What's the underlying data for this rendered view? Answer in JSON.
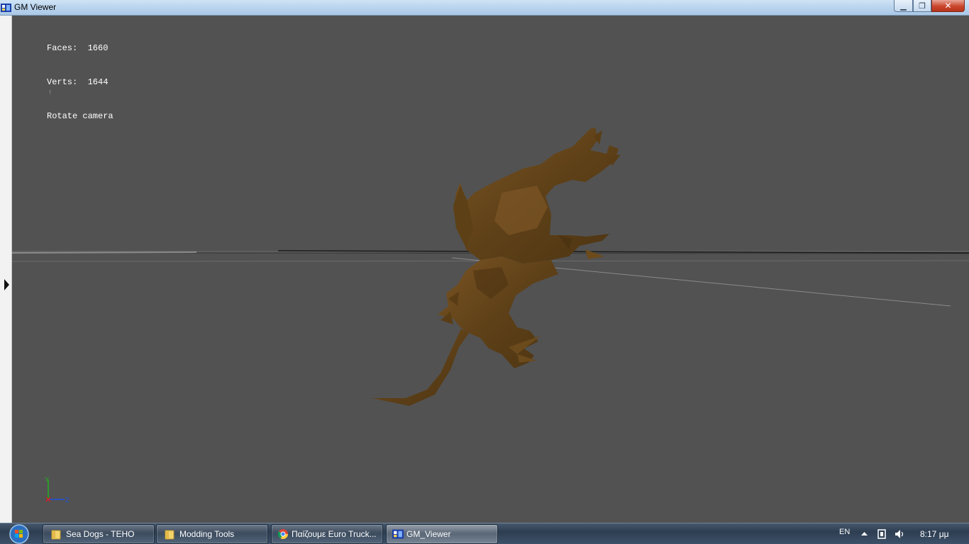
{
  "window": {
    "title": "GM Viewer",
    "icon": "gm-viewer-app-icon",
    "controls": {
      "minimize": "▁",
      "maximize": "❐",
      "close": "✕"
    }
  },
  "sidebar": {
    "toggle_icon": "triangle-right-icon"
  },
  "hud": {
    "faces_line": "Faces:  1660",
    "verts_line": "Verts:  1644",
    "mode_line": "Rotate camera",
    "marker": "!"
  },
  "axis_gizmo": {
    "y_label": "Y",
    "x_label": "X",
    "z_label": "Z"
  },
  "colors": {
    "viewport_bg": "#525252",
    "model_brown": "#6b4a1c",
    "axis_x": "#d22020",
    "axis_y": "#20b020",
    "axis_z": "#2050e0"
  },
  "taskbar": {
    "items": [
      {
        "label": "Sea Dogs - TEHO",
        "icon": "folder-icon",
        "active": false
      },
      {
        "label": "Modding Tools",
        "icon": "folder-icon",
        "active": false
      },
      {
        "label": "Παίζουμε Euro Truck...",
        "icon": "chrome-icon",
        "active": false
      },
      {
        "label": "GM_Viewer",
        "icon": "gm-viewer-app-icon",
        "active": true
      }
    ],
    "language": "EN",
    "clock": "8:17 μμ"
  }
}
